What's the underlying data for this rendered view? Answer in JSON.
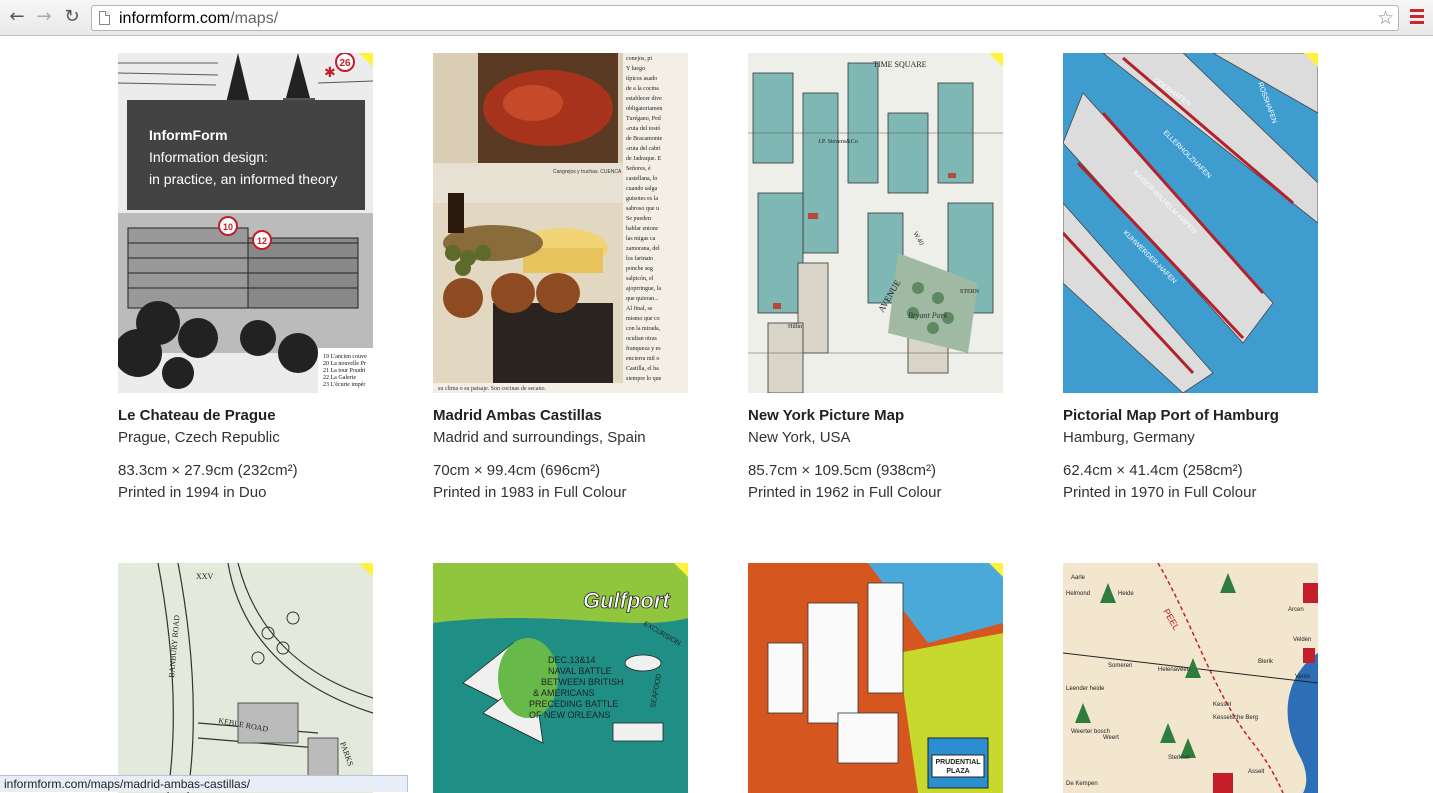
{
  "browser": {
    "url_domain": "informform.com",
    "url_path": "/maps/",
    "status_url": "informform.com/maps/madrid-ambas-castillas/"
  },
  "overlay": {
    "brand": "InformForm",
    "line1": "Information design:",
    "line2": "in practice, an informed theory"
  },
  "maps": [
    {
      "title": "Le Chateau de Prague",
      "location": "Prague, Czech Republic",
      "dimensions": "83.3cm × 27.9cm (232cm²)",
      "printed": "Printed in 1994 in Duo"
    },
    {
      "title": "Madrid Ambas Castillas",
      "location": "Madrid and surroundings, Spain",
      "dimensions": "70cm × 99.4cm (696cm²)",
      "printed": "Printed in 1983 in Full Colour"
    },
    {
      "title": "New York Picture Map",
      "location": "New York, USA",
      "dimensions": "85.7cm × 109.5cm (938cm²)",
      "printed": "Printed in 1962 in Full Colour"
    },
    {
      "title": "Pictorial Map Port of Hamburg",
      "location": "Hamburg, Germany",
      "dimensions": "62.4cm × 41.4cm (258cm²)",
      "printed": "Printed in 1970 in Full Colour"
    }
  ],
  "thumb_text": {
    "prague_badge": "26",
    "prague_marker_a": "10",
    "prague_marker_b": "12",
    "prague_legend": [
      "19 L'ancien couve",
      "20 La nouvelle Pr",
      "21 La tour Poudri",
      "22 La Galerie",
      "23 L'écurie impér"
    ],
    "madrid_caption": "Cangrejos y truchas. CUENCA",
    "madrid_footer": "su clima o su paisaje. Son cocinas de secano.",
    "madrid_column": [
      "conejos, pi",
      "Y luego",
      "típicos asado",
      "de a la cocina",
      "establecer dive",
      "obligatoriamen",
      "Turégano, Ped",
      "«ruta del tostó",
      "de Bracamonte",
      "«ruta del cabri",
      "de Jadraque. E",
      "Señores, é",
      "castellana, lo",
      "cuando salga",
      "guisotes es la",
      "sabroso que u",
      "Se pueden",
      "hablar entonc",
      "las migas ca",
      "zamorana, del",
      "los farinato",
      "ponche seg",
      "salpicón, el",
      "ajoprringue, la",
      "que quieran...",
      "Al final, se",
      "mismo que co",
      "con la mirada,",
      "ocultan otras",
      "franqueza y es",
      "encierra mil o",
      "Castilla, el ha",
      "siempre lo que"
    ],
    "ny_top": "TIME SQUARE",
    "ny_sign": "J.P. Stevens&Co",
    "ny_avenue": "AVENUE",
    "ny_park": "Bryant Park",
    "ny_w40": "W.40",
    "ny_stern": "STERN",
    "ny_hilton": "Hilltn",
    "hamburg_labels": [
      "ODERHAFEN",
      "ELLERHOLZHAFEN",
      "KAISER-WILHELM-HAFEN",
      "KUHWERDER-HAFEN",
      "ROSSHAFEN"
    ],
    "oxford_roads": [
      "BANBURY ROAD",
      "KEBLE ROAD",
      "PARKS",
      "XXV"
    ],
    "gulfport_text": [
      "Gulfport",
      "EXCURSION",
      "DEC.13&14",
      "NAVAL BATTLE",
      "BETWEEN BRITISH",
      "& AMERICANS",
      "PRECEDING BATTLE",
      "OF NEW ORLEANS",
      "SEAFOOD"
    ],
    "boston_sign": [
      "PRUDENTIAL",
      "PLAZA"
    ],
    "limburg_places": [
      "Aarle",
      "Heide",
      "Helmond",
      "Someren",
      "Helenaveen",
      "Kessel",
      "Blerik",
      "Venlo",
      "Leender heide",
      "Weert",
      "Sterksel",
      "De Kempen",
      "Arcen",
      "Velden",
      "Asselt",
      "PEEL",
      "Kesselsche Berg",
      "Weerter bosch"
    ]
  }
}
